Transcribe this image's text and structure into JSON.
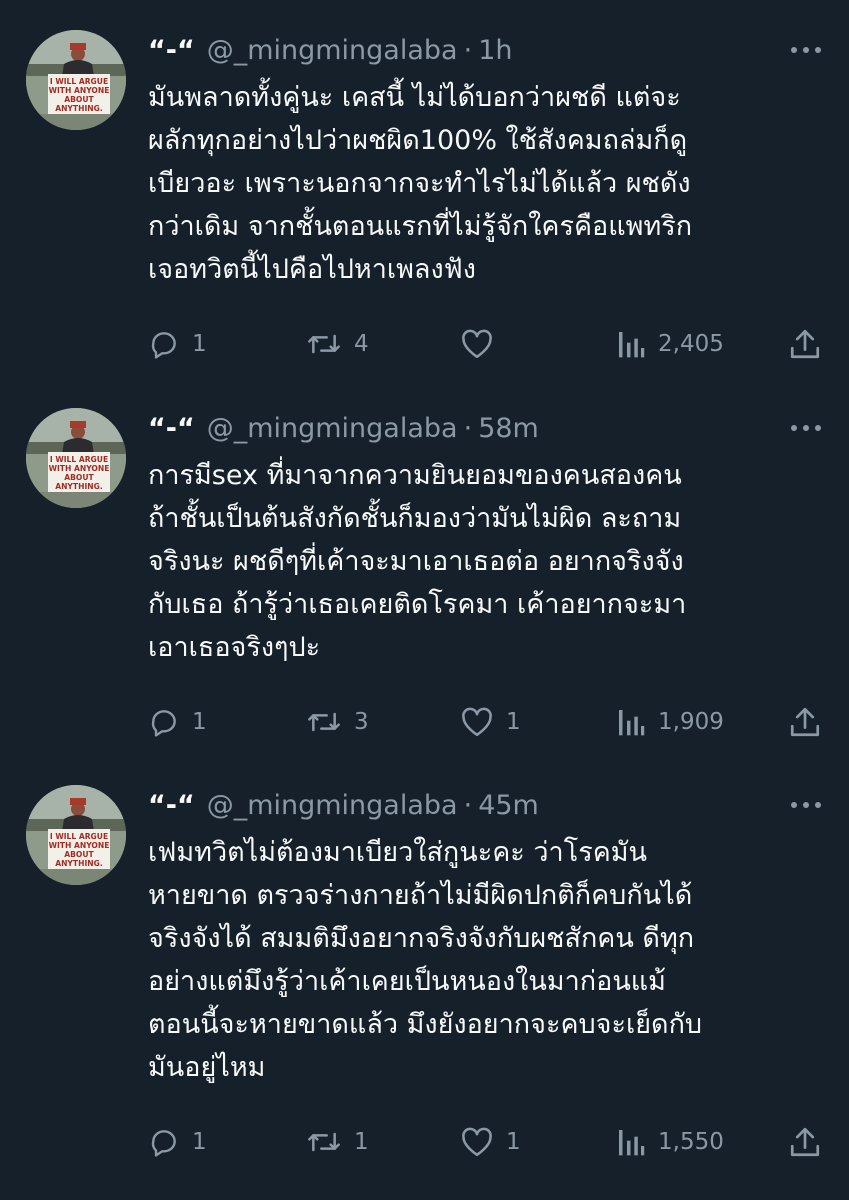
{
  "colors": {
    "background": "#15202b",
    "text": "#f7f9f9",
    "muted": "#8b98a5"
  },
  "tweets": [
    {
      "name": "“-“",
      "handle": "@_mingmingalaba",
      "separator": "·",
      "time": "1h",
      "avatar_sign": [
        "I WILL ARGUE",
        "WITH ANYONE",
        "ABOUT",
        "ANYTHING."
      ],
      "lines": [
        "มันพลาดทั้งคู่นะ เคสนี้ ไม่ได้บอกว่าผชดี แต่จะ",
        "ผลักทุกอย่างไปว่าผชผิด100% ใช้สังคมถล่มก็ดู",
        "เบียวอะ เพราะนอกจากจะทำไรไม่ได้แล้ว ผชดัง",
        "กว่าเดิม จากชั้นตอนแรกที่ไม่รู้จักใครคือแพทริก",
        "เจอทวิตนี้ไปคือไปหาเพลงฟัง"
      ],
      "replies": "1",
      "retweets": "4",
      "likes": "",
      "views": "2,405",
      "icons": [
        "reply-icon",
        "retweet-icon",
        "like-icon",
        "views-icon",
        "share-icon",
        "more-icon"
      ]
    },
    {
      "name": "“-“",
      "handle": "@_mingmingalaba",
      "separator": "·",
      "time": "58m",
      "avatar_sign": [
        "I WILL ARGUE",
        "WITH ANYONE",
        "ABOUT",
        "ANYTHING."
      ],
      "lines": [
        "การมีsex ที่มาจากความยินยอมของคนสองคน",
        "ถ้าชั้นเป็นต้นสังกัดชั้นก็มองว่ามันไม่ผิด ละถาม",
        "จริงนะ ผชดีๆที่เค้าจะมาเอาเธอต่อ อยากจริงจัง",
        "กับเธอ ถ้ารู้ว่าเธอเคยติดโรคมา เค้าอยากจะมา",
        "เอาเธอจริงๆปะ"
      ],
      "replies": "1",
      "retweets": "3",
      "likes": "1",
      "views": "1,909",
      "icons": [
        "reply-icon",
        "retweet-icon",
        "like-icon",
        "views-icon",
        "share-icon",
        "more-icon"
      ]
    },
    {
      "name": "“-“",
      "handle": "@_mingmingalaba",
      "separator": "·",
      "time": "45m",
      "avatar_sign": [
        "I WILL ARGUE",
        "WITH ANYONE",
        "ABOUT",
        "ANYTHING."
      ],
      "lines": [
        "เฟมทวิตไม่ต้องมาเบียวใส่กูนะคะ ว่าโรคมัน",
        "หายขาด ตรวจร่างกายถ้าไม่มีผิดปกติก็คบกันได้",
        "จริงจังได้ สมมติมึงอยากจริงจังกับผชสักคน ดีทุก",
        "อย่างแต่มึงรู้ว่าเค้าเคยเป็นหนองในมาก่อนแม้",
        "ตอนนี้จะหายขาดแล้ว มึงยังอยากจะคบจะเย็ดกับ",
        "มันอยู่ไหม"
      ],
      "replies": "1",
      "retweets": "1",
      "likes": "1",
      "views": "1,550",
      "icons": [
        "reply-icon",
        "retweet-icon",
        "like-icon",
        "views-icon",
        "share-icon",
        "more-icon"
      ]
    }
  ]
}
